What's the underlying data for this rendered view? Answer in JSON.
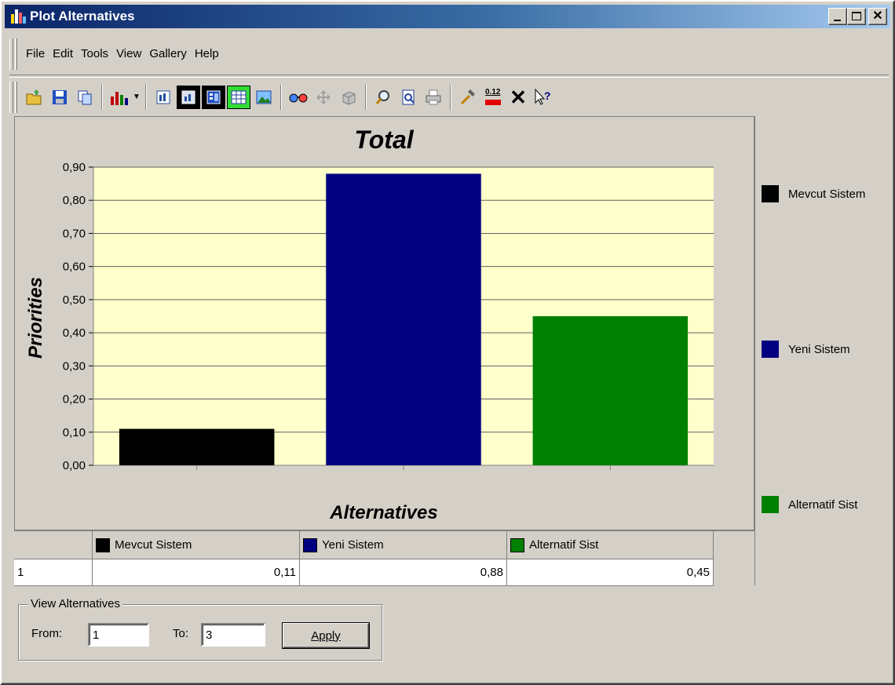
{
  "window": {
    "title": "Plot Alternatives",
    "controls": {
      "minimize": "_",
      "maximize": "□",
      "close": "×"
    }
  },
  "menu": [
    {
      "label": "File",
      "accel": "F"
    },
    {
      "label": "Edit",
      "accel": "E"
    },
    {
      "label": "Tools",
      "accel": "T"
    },
    {
      "label": "View",
      "accel": "V"
    },
    {
      "label": "Gallery",
      "accel": "G"
    },
    {
      "label": "Help",
      "accel": "H"
    }
  ],
  "toolbar": {
    "value_format_icon_text": "0.12"
  },
  "colors": {
    "plot_background": "#ffffcc",
    "mevcut": "#000000",
    "yeni": "#000080",
    "alternatif": "#008000"
  },
  "chart_data": {
    "type": "bar",
    "title": "Total",
    "xlabel": "Alternatives",
    "ylabel": "Priorities",
    "categories": [
      "Mevcut Sistem",
      "Yeni Sistem",
      "Alternatif Sist"
    ],
    "values": [
      0.11,
      0.88,
      0.45
    ],
    "colors": [
      "#000000",
      "#000080",
      "#008000"
    ],
    "ylim": [
      0,
      0.9
    ],
    "yticks": [
      "0,00",
      "0,10",
      "0,20",
      "0,30",
      "0,40",
      "0,50",
      "0,60",
      "0,70",
      "0,80",
      "0,90"
    ],
    "grid": true,
    "legend": "right"
  },
  "legend": [
    {
      "label": "Mevcut Sistem",
      "color": "#000000"
    },
    {
      "label": "Yeni Sistem",
      "color": "#000080"
    },
    {
      "label": "Alternatif Sist",
      "color": "#008000"
    }
  ],
  "grid": {
    "headers": [
      "Mevcut Sistem",
      "Yeni Sistem",
      "Alternatif Sist"
    ],
    "rows": [
      {
        "label": "1",
        "values": [
          "0,11",
          "0,88",
          "0,45"
        ]
      }
    ]
  },
  "view_alternatives": {
    "group_label": "View Alternatives",
    "from_label": "From:",
    "from_value": "1",
    "to_label": "To:",
    "to_value": "3",
    "apply_label": "Apply"
  }
}
